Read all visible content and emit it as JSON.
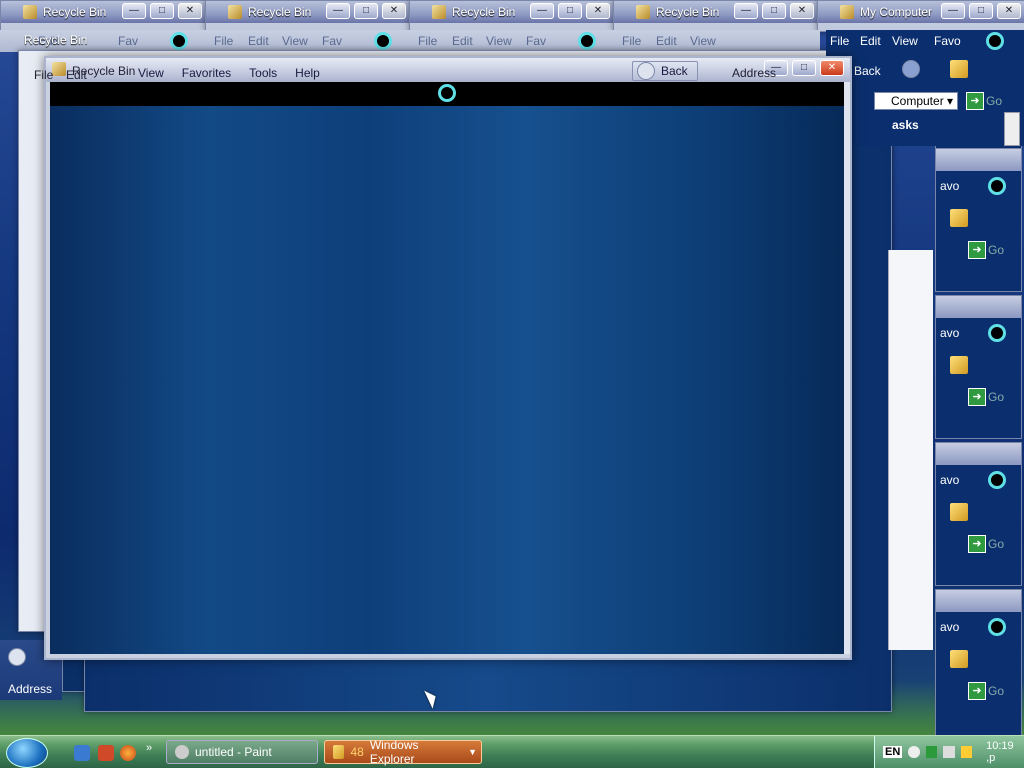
{
  "titlebar_tabs": [
    {
      "label": "Recycle Bin"
    },
    {
      "label": "Recycle Bin"
    },
    {
      "label": "Recycle Bin"
    },
    {
      "label": "Recycle Bin"
    },
    {
      "label": "My Computer"
    }
  ],
  "ghost_menu": {
    "file": "File",
    "edit": "Edit",
    "view": "View",
    "favorites": "Fav"
  },
  "second_window_title": "Recycle Bin",
  "main_window": {
    "title": "Recycle Bin",
    "menu": [
      "File",
      "Edit",
      "View",
      "Favorites",
      "Tools",
      "Help"
    ]
  },
  "toolbar": {
    "back": "Back",
    "address": "Address",
    "go": "Go"
  },
  "right_panel": {
    "menu_edit": "Edit",
    "menu_view": "View",
    "menu_fav": "Favo",
    "back": "Back",
    "address_value": "Computer",
    "tasks": "asks",
    "go": "Go",
    "fav_short": "avo"
  },
  "left_address_label": "Address",
  "taskbar": {
    "paint_label": "untitled - Paint",
    "explorer_count": "48",
    "explorer_label": "Windows Explorer",
    "lang": "EN",
    "clock": "10:19 ,p"
  }
}
